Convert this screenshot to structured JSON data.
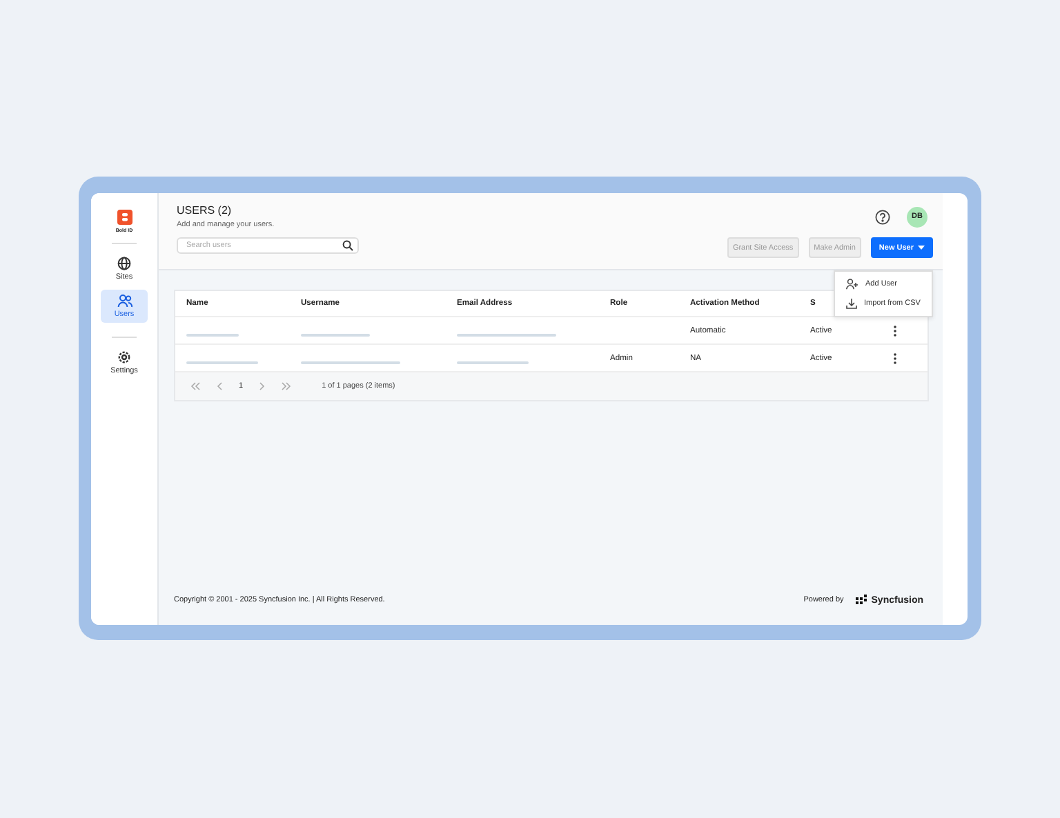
{
  "sidebar": {
    "logo_text": "Bold ID",
    "items": [
      {
        "label": "Sites",
        "kind": "globe",
        "selected": false
      },
      {
        "label": "Users",
        "kind": "users",
        "selected": true
      },
      {
        "label": "Settings",
        "kind": "gear",
        "selected": false
      }
    ]
  },
  "header": {
    "title": "USERS (2)",
    "subtitle": "Add and manage your users.",
    "avatar": "DB"
  },
  "search": {
    "placeholder": "Search users"
  },
  "actions": [
    {
      "label": "Grant Site Access",
      "kind": "disabled"
    },
    {
      "label": "Make Admin",
      "kind": "disabled"
    },
    {
      "label": "New User",
      "kind": "primary"
    }
  ],
  "menu": [
    {
      "label": "Add User",
      "kind": "add"
    },
    {
      "label": "Import from CSV",
      "kind": "import"
    }
  ],
  "table": {
    "columns": [
      "Name",
      "Username",
      "Email Address",
      "Role",
      "Activation Method",
      "S"
    ],
    "rows": [
      {
        "role": "",
        "activation": "Automatic",
        "status": "Active"
      },
      {
        "role": "Admin",
        "activation": "NA",
        "status": "Active"
      }
    ]
  },
  "pager": {
    "page": "1",
    "summary": "1 of 1 pages (2 items)"
  },
  "footer": {
    "copyright": "Copyright © 2001 - 2025 Syncfusion Inc. | All Rights Reserved.",
    "powered": "Powered by",
    "brand": "Syncfusion"
  }
}
